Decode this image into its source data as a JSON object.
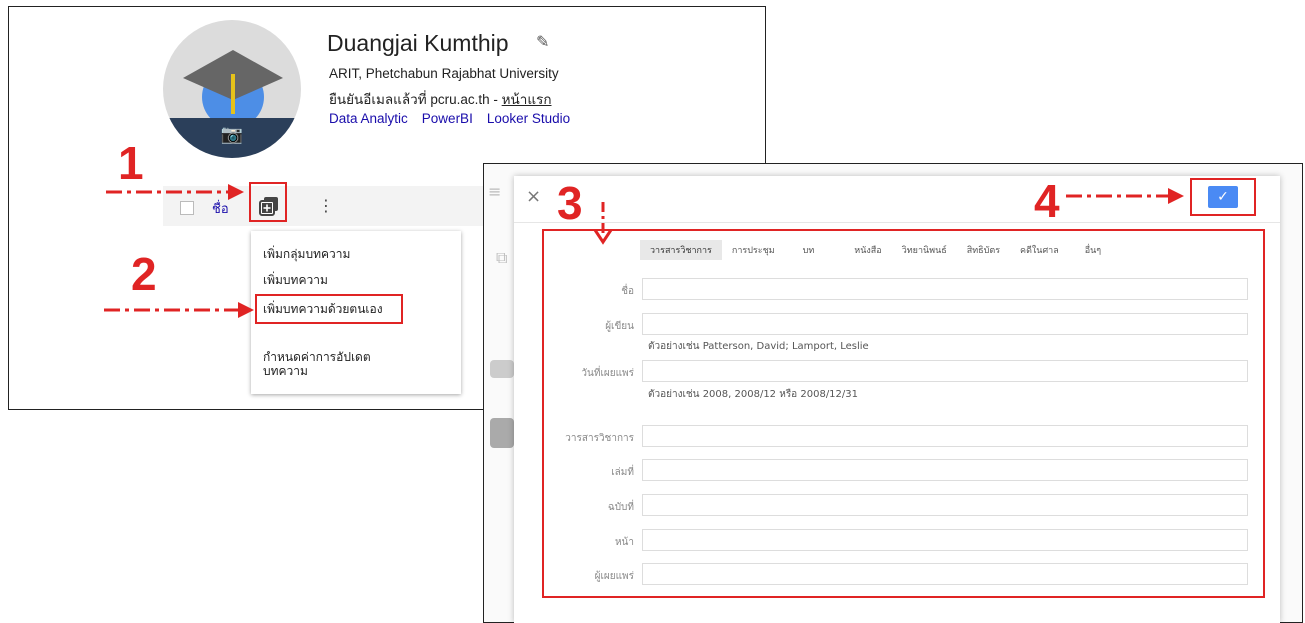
{
  "profile": {
    "name": "Duangjai Kumthip",
    "affiliation": "ARIT, Phetchabun Rajabhat University",
    "email_text": "ยืนยันอีเมลแล้วที่ pcru.ac.th",
    "email_sep": " - ",
    "home_link": "หน้าแรก",
    "tags": [
      "Data Analytic",
      "PowerBI",
      "Looker Studio"
    ]
  },
  "toolbar": {
    "sort_title": "ชื่อ",
    "more": "⋮"
  },
  "add_menu": {
    "items": [
      "เพิ่มกลุ่มบทความ",
      "เพิ่มบทความ",
      "เพิ่มบทความด้วยตนเอง",
      "กำหนดค่าการอัปเดต",
      "บทความ"
    ]
  },
  "steps": [
    "1",
    "2",
    "3",
    "4"
  ],
  "dialog": {
    "close": "×",
    "save": "✓",
    "types": [
      "วารสารวิชาการ",
      "การประชุม",
      "บท",
      "หนังสือ",
      "วิทยานิพนธ์",
      "สิทธิบัตร",
      "คดีในศาล",
      "อื่นๆ"
    ],
    "fields": {
      "title": "ชื่อ",
      "authors": "ผู้เขียน",
      "authors_hint": "ตัวอย่างเช่น Patterson, David; Lamport, Leslie",
      "date": "วันที่เผยแพร่",
      "date_hint": "ตัวอย่างเช่น 2008, 2008/12 หรือ 2008/12/31",
      "journal": "วารสารวิชาการ",
      "volume": "เล่มที่",
      "issue": "ฉบับที่",
      "pages": "หน้า",
      "publisher": "ผู้เผยแพร่"
    }
  },
  "colors": {
    "annotation_red": "#e02424",
    "link_blue": "#1a0dab",
    "save_blue": "#4a8af4"
  }
}
